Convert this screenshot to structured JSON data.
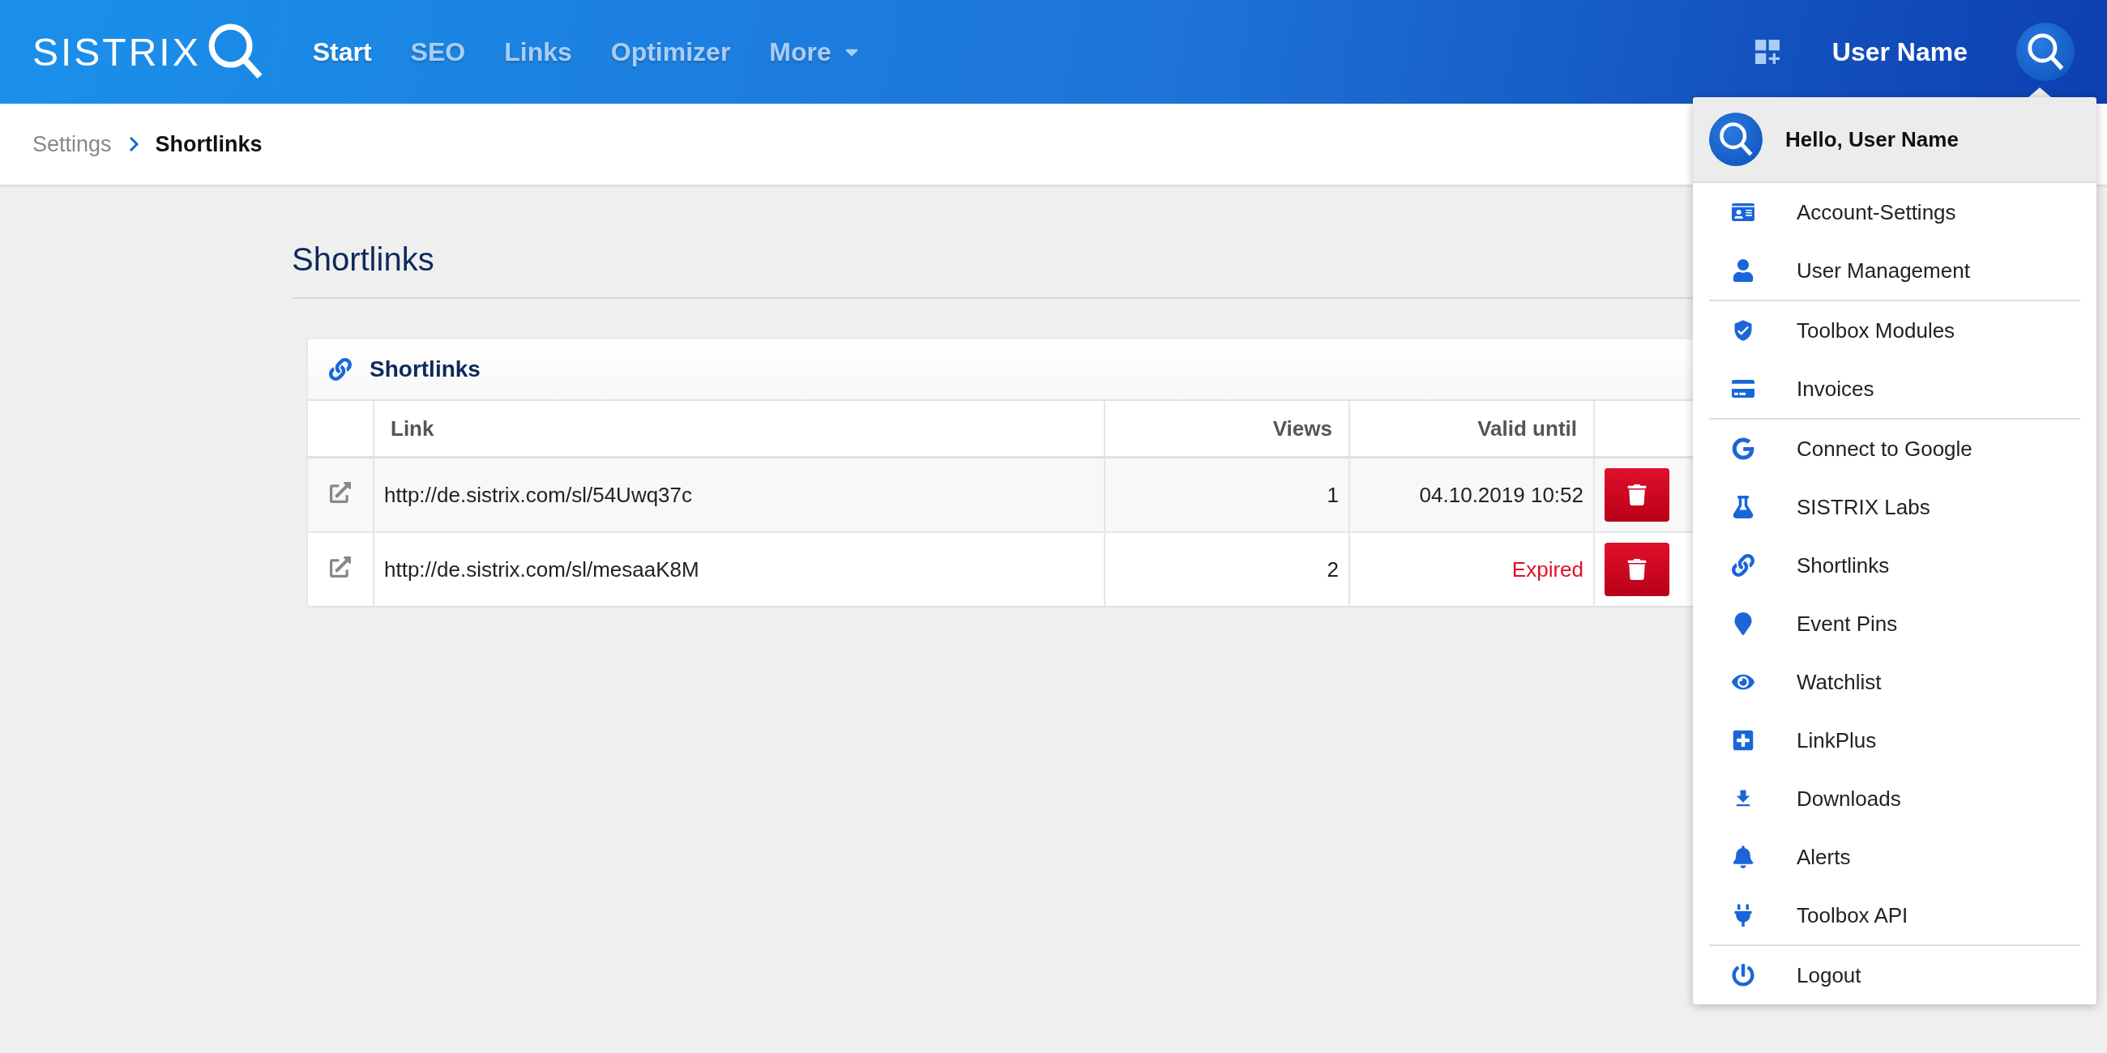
{
  "header": {
    "logo": "SISTRIX",
    "nav": [
      {
        "label": "Start",
        "selected": true
      },
      {
        "label": "SEO",
        "selected": false
      },
      {
        "label": "Links",
        "selected": false
      },
      {
        "label": "Optimizer",
        "selected": false
      },
      {
        "label": "More",
        "selected": false,
        "dropdown": true
      }
    ],
    "user_name": "User Name"
  },
  "breadcrumb": [
    "Settings",
    "Shortlinks"
  ],
  "page_title": "Shortlinks",
  "card": {
    "title": "Shortlinks",
    "columns": [
      "Link",
      "Views",
      "Valid until"
    ],
    "rows": [
      {
        "link": "http://de.sistrix.com/sl/54Uwq37c",
        "views": "1",
        "valid_until": "04.10.2019 10:52",
        "expired": false
      },
      {
        "link": "http://de.sistrix.com/sl/mesaaK8M",
        "views": "2",
        "valid_until": "Expired",
        "expired": true
      }
    ]
  },
  "user_menu": {
    "greeting": "Hello, User Name",
    "groups": [
      [
        "Account-Settings",
        "User Management"
      ],
      [
        "Toolbox Modules",
        "Invoices"
      ],
      [
        "Connect to Google",
        "SISTRIX Labs",
        "Shortlinks",
        "Event Pins",
        "Watchlist",
        "LinkPlus",
        "Downloads",
        "Alerts",
        "Toolbox API"
      ],
      [
        "Logout"
      ]
    ]
  }
}
